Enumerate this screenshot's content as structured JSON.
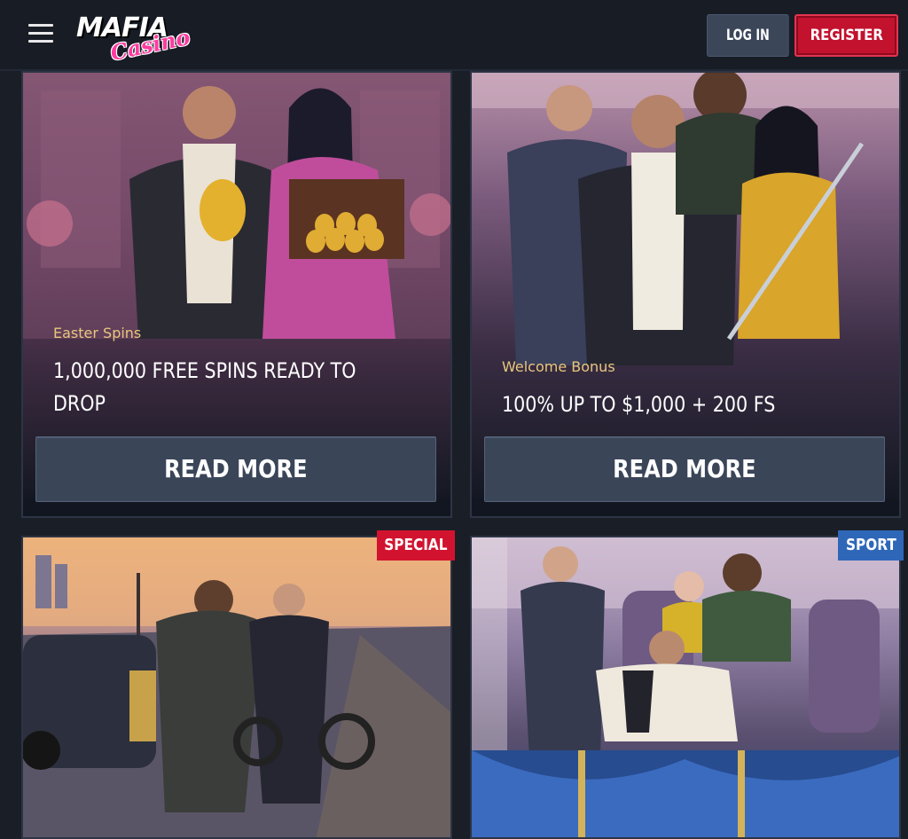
{
  "header": {
    "logo_main": "MAFIA",
    "logo_sub": "Casino",
    "login_label": "LOG IN",
    "register_label": "REGISTER"
  },
  "promos": [
    {
      "tag": "Easter Spins",
      "headline": "1,000,000 FREE SPINS READY TO DROP",
      "button": "READ MORE"
    },
    {
      "tag": "Welcome Bonus",
      "headline": "100% UP TO $1,000 + 200 FS",
      "button": "READ MORE"
    }
  ],
  "games": [
    {
      "badge": "SPECIAL",
      "badge_color": "#d2132f"
    },
    {
      "badge": "SPORT",
      "badge_color": "#2f67b8"
    }
  ],
  "colors": {
    "background": "#1a1e27",
    "accent_red": "#c3122e",
    "accent_gold": "#e8c77c",
    "button_gray": "#3a4558"
  }
}
